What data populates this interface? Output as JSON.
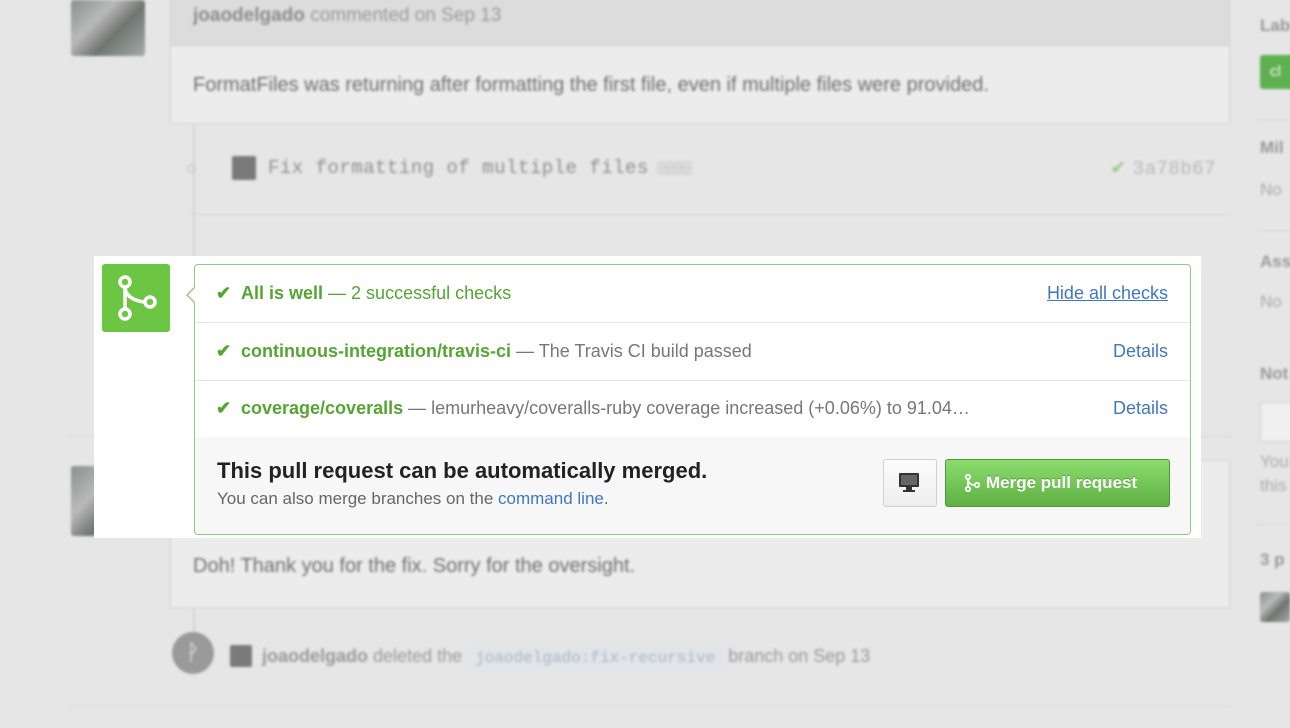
{
  "background": {
    "comment1": {
      "author": "joaodelgado",
      "action": "commented on Sep 13",
      "body": "FormatFiles was returning after formatting the first file, even if multiple files were provided."
    },
    "commit": {
      "message": "Fix formatting of multiple files",
      "ellipsis": "···",
      "sha": "3a78b67"
    },
    "comment2": {
      "body": "Doh! Thank you for the fix. Sorry for the oversight."
    },
    "branch_event": {
      "author": "joaodelgado",
      "action": "deleted the",
      "branch": "joaodelgado:fix-recursive",
      "suffix": "branch on Sep 13"
    },
    "sidebar": {
      "labels_heading": "Lab",
      "label_chip": "cl",
      "milestone_heading": "Mil",
      "milestone_value": "No",
      "assignee_heading": "Ass",
      "assignee_value": "No",
      "notifications_heading": "Not",
      "notifications_text_1": "You",
      "notifications_text_2": "this",
      "participants_heading": "3 p"
    }
  },
  "merge_panel": {
    "status": {
      "check_icon": "checkmark-icon",
      "title": "All is well",
      "summary": "— 2 successful checks",
      "toggle_link": "Hide all checks"
    },
    "checks": [
      {
        "context": "continuous-integration/travis-ci",
        "description": "— The Travis CI build passed",
        "details_label": "Details"
      },
      {
        "context": "coverage/coveralls",
        "description": "— lemurheavy/coveralls-ruby coverage increased (+0.06%) to 91.04…",
        "details_label": "Details"
      }
    ],
    "merge": {
      "heading": "This pull request can be automatically merged.",
      "note_prefix": "You can also merge branches on the",
      "note_link": "command line",
      "note_suffix": ".",
      "command_line_button_icon": "desktop-icon",
      "merge_button_icon": "git-merge-icon",
      "merge_button_label": "Merge pull request"
    },
    "colors": {
      "success_green": "#55a532",
      "merge_icon_bg": "#6cc644",
      "link_blue": "#4078c0"
    }
  }
}
